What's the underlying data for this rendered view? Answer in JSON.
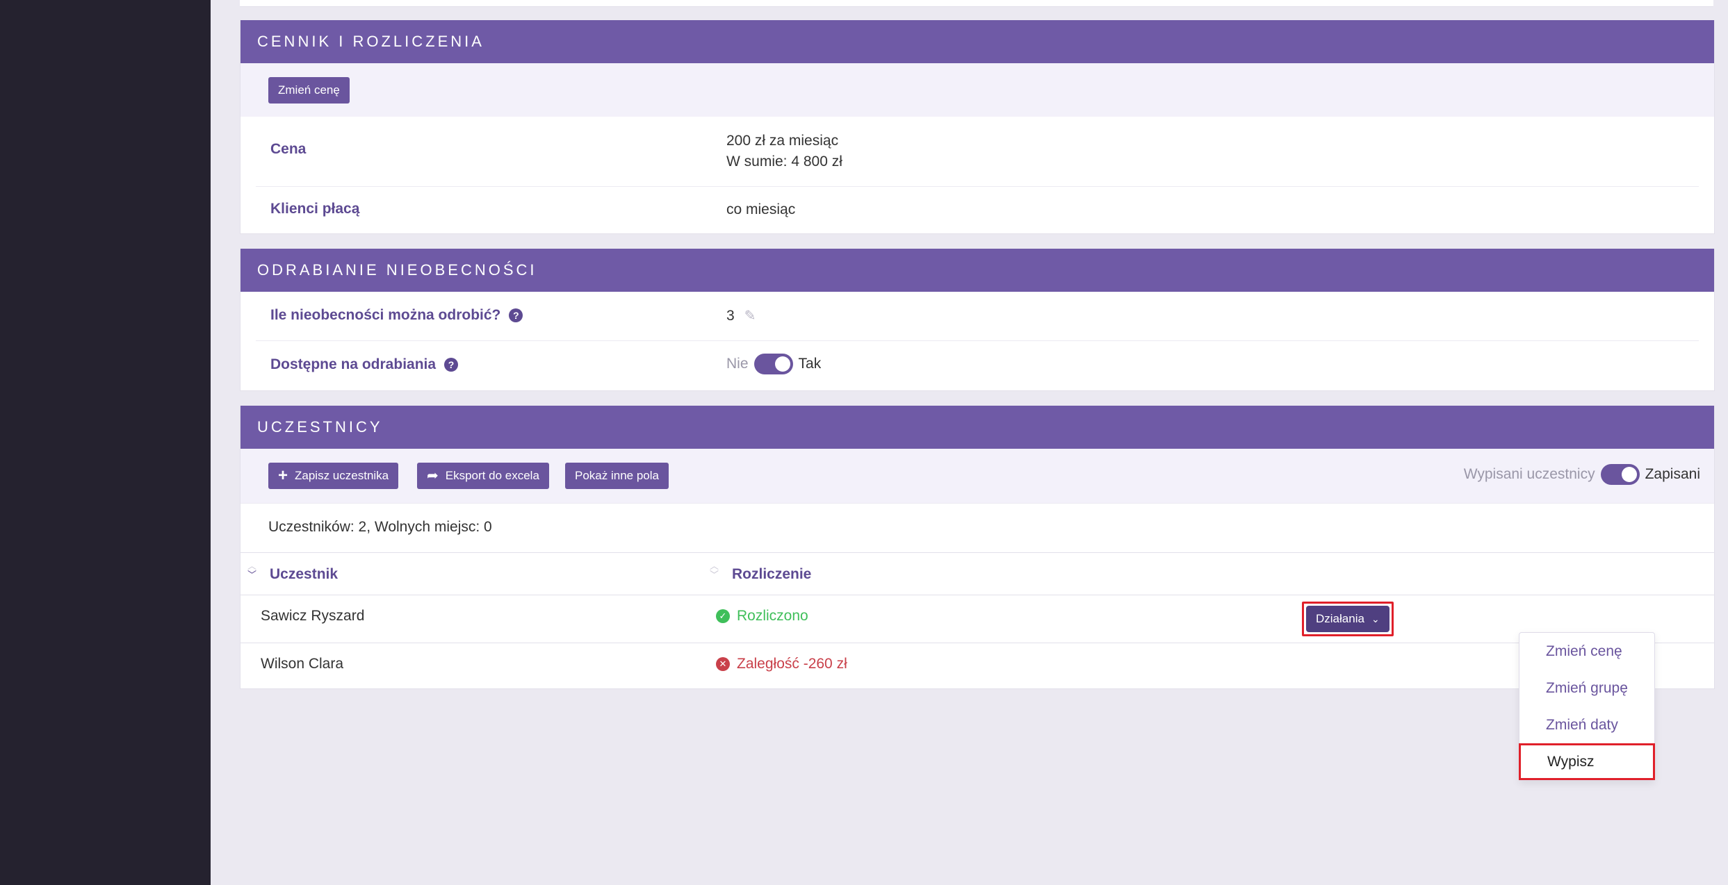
{
  "pricing": {
    "header": "CENNIK I ROZLICZENIA",
    "change_price_button": "Zmień cenę",
    "rows": [
      {
        "label": "Cena",
        "value_line1": "200 zł za miesiąc",
        "value_line2": "W sumie: 4 800 zł"
      },
      {
        "label": "Klienci płacą",
        "value": "co miesiąc"
      }
    ]
  },
  "makeup": {
    "header": "ODRABIANIE NIEOBECNOŚCI",
    "rows": [
      {
        "label": "Ile nieobecności można odrobić?",
        "value": "3",
        "help": "?"
      },
      {
        "label": "Dostępne na odrabiania",
        "help": "?",
        "toggle_off_label": "Nie",
        "toggle_on_label": "Tak",
        "toggle_on": true
      }
    ]
  },
  "participants": {
    "header": "UCZESTNICY",
    "buttons": {
      "add": "Zapisz uczestnika",
      "export": "Eksport do excela",
      "fields": "Pokaż inne pola"
    },
    "filter": {
      "off_label": "Wypisani uczestnicy",
      "on_label": "Zapisani",
      "on": true
    },
    "summary": "Uczestników: 2, Wolnych miejsc: 0",
    "columns": [
      "Uczestnik",
      "Rozliczenie"
    ],
    "rows": [
      {
        "name": "Sawicz Ryszard",
        "status": "Rozliczono",
        "status_type": "ok"
      },
      {
        "name": "Wilson Clara",
        "status": "Zaległość -260 zł",
        "status_type": "debt"
      }
    ],
    "actions_button": "Działania",
    "actions_menu": [
      "Zmień cenę",
      "Zmień grupę",
      "Zmień daty",
      "Wypisz"
    ]
  },
  "colors": {
    "primary": "#6f5aa6",
    "ok": "#3fbf5a",
    "debt": "#c9404a",
    "sidebar": "#25222f",
    "highlight": "#e0202a"
  }
}
